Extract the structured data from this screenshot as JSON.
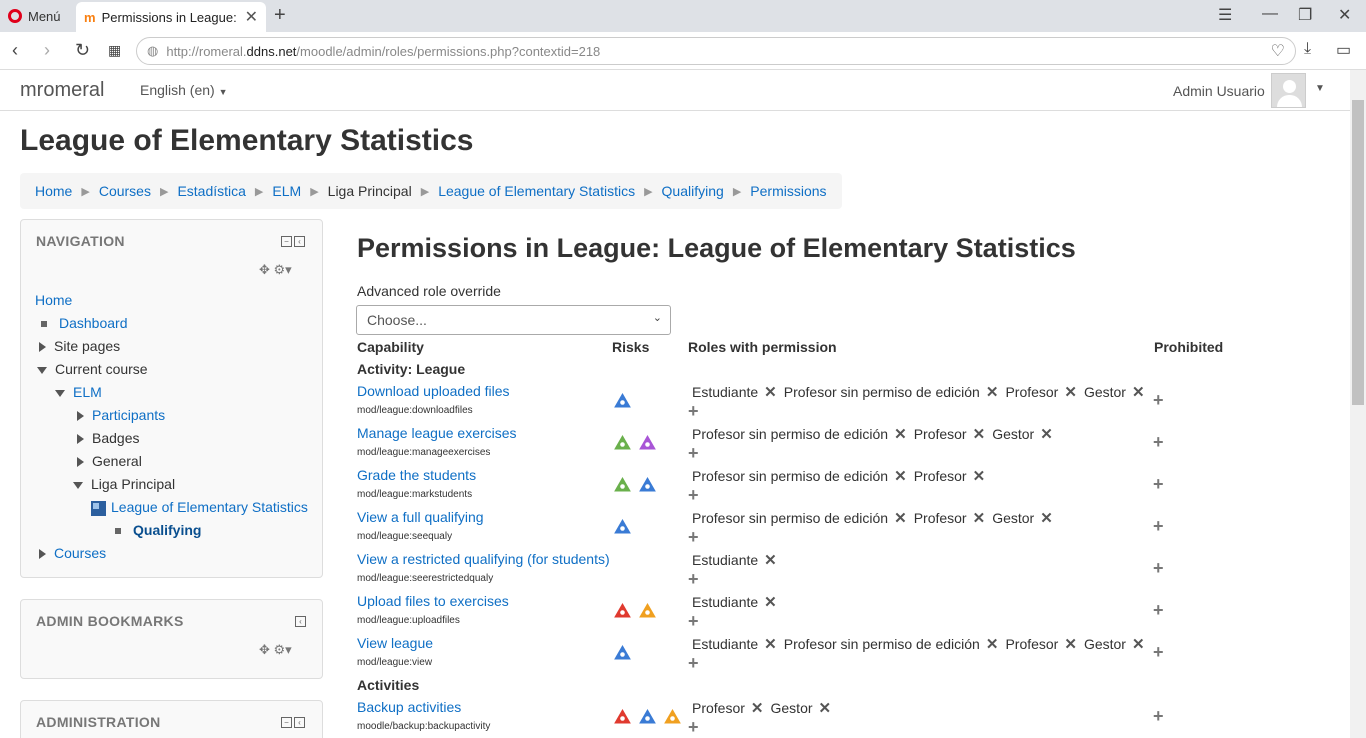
{
  "browser": {
    "menu_label": "Menú",
    "tab_title": "Permissions in League: Lea",
    "url_prefix": "http://romeral.",
    "url_host": "ddns.net",
    "url_path": "/moodle/admin/roles/permissions.php?contextid=218"
  },
  "navbar": {
    "brand": "mromeral",
    "language": "English (en)",
    "user": "Admin Usuario"
  },
  "page": {
    "heading": "League of Elementary Statistics",
    "breadcrumb": [
      {
        "label": "Home",
        "link": true
      },
      {
        "label": "Courses",
        "link": true
      },
      {
        "label": "Estadística",
        "link": true
      },
      {
        "label": "ELM",
        "link": true
      },
      {
        "label": "Liga Principal",
        "link": false
      },
      {
        "label": "League of Elementary Statistics",
        "link": true
      },
      {
        "label": "Qualifying",
        "link": true
      },
      {
        "label": "Permissions",
        "link": true
      }
    ]
  },
  "navigation": {
    "title": "NAVIGATION",
    "home": "Home",
    "dashboard": "Dashboard",
    "site_pages": "Site pages",
    "current_course": "Current course",
    "elm": "ELM",
    "participants": "Participants",
    "badges": "Badges",
    "general": "General",
    "liga_principal": "Liga Principal",
    "league": "League of Elementary Statistics",
    "qualifying": "Qualifying",
    "courses": "Courses"
  },
  "admin_bookmarks": {
    "title": "ADMIN BOOKMARKS"
  },
  "administration": {
    "title": "ADMINISTRATION"
  },
  "main": {
    "title": "Permissions in League: League of Elementary Statistics",
    "advanced_label": "Advanced role override",
    "select_value": "Choose...",
    "headers": {
      "capability": "Capability",
      "risks": "Risks",
      "roles": "Roles with permission",
      "prohibited": "Prohibited"
    },
    "section1": "Activity: League",
    "section2": "Activities",
    "rows": [
      {
        "name": "Download uploaded files",
        "code": "mod/league:downloadfiles",
        "risks": [
          "blue"
        ],
        "roles": [
          "Estudiante",
          "Profesor sin permiso de edición",
          "Profesor",
          "Gestor"
        ]
      },
      {
        "name": "Manage league exercises",
        "code": "mod/league:manageexercises",
        "risks": [
          "green",
          "purple"
        ],
        "roles": [
          "Profesor sin permiso de edición",
          "Profesor",
          "Gestor"
        ]
      },
      {
        "name": "Grade the students",
        "code": "mod/league:markstudents",
        "risks": [
          "green",
          "blue"
        ],
        "roles": [
          "Profesor sin permiso de edición",
          "Profesor"
        ]
      },
      {
        "name": "View a full qualifying",
        "code": "mod/league:seequaly",
        "risks": [
          "blue"
        ],
        "roles": [
          "Profesor sin permiso de edición",
          "Profesor",
          "Gestor"
        ]
      },
      {
        "name": "View a restricted qualifying (for students)",
        "code": "mod/league:seerestrictedqualy",
        "risks": [],
        "roles": [
          "Estudiante"
        ]
      },
      {
        "name": "Upload files to exercises",
        "code": "mod/league:uploadfiles",
        "risks": [
          "red",
          "orange"
        ],
        "roles": [
          "Estudiante"
        ]
      },
      {
        "name": "View league",
        "code": "mod/league:view",
        "risks": [
          "blue"
        ],
        "roles": [
          "Estudiante",
          "Profesor sin permiso de edición",
          "Profesor",
          "Gestor"
        ]
      },
      {
        "name": "Backup activities",
        "code": "moodle/backup:backupactivity",
        "risks": [
          "red",
          "blue",
          "orange"
        ],
        "roles": [
          "Profesor",
          "Gestor"
        ]
      }
    ]
  },
  "colors": {
    "link": "#0f6fc5",
    "risk_blue": "#3a7bd5",
    "risk_green": "#6ab04c",
    "risk_purple": "#a855d6",
    "risk_red": "#e03a2f",
    "risk_orange": "#f0a020"
  }
}
